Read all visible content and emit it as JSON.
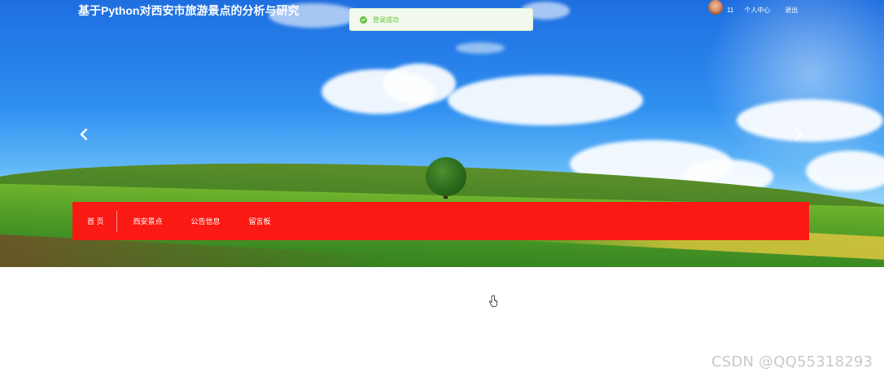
{
  "site": {
    "title": "基于Python对西安市旅游景点的分析与研究"
  },
  "toast": {
    "message": "登录成功",
    "type": "success"
  },
  "user": {
    "name": "11",
    "center_label": "个人中心",
    "logout_label": "退出"
  },
  "nav": {
    "items": [
      {
        "label": "首 页"
      },
      {
        "label": "西安景点"
      },
      {
        "label": "公告信息"
      },
      {
        "label": "留言板"
      }
    ],
    "background": "#fb1a13"
  },
  "carousel": {
    "prev_icon": "chevron-left-icon",
    "next_icon": "chevron-right-icon"
  },
  "watermark": "CSDN @QQ55318293",
  "colors": {
    "nav": "#fb1a13",
    "toast_text": "#67c23a",
    "toast_bg": "#f0f9eb"
  }
}
